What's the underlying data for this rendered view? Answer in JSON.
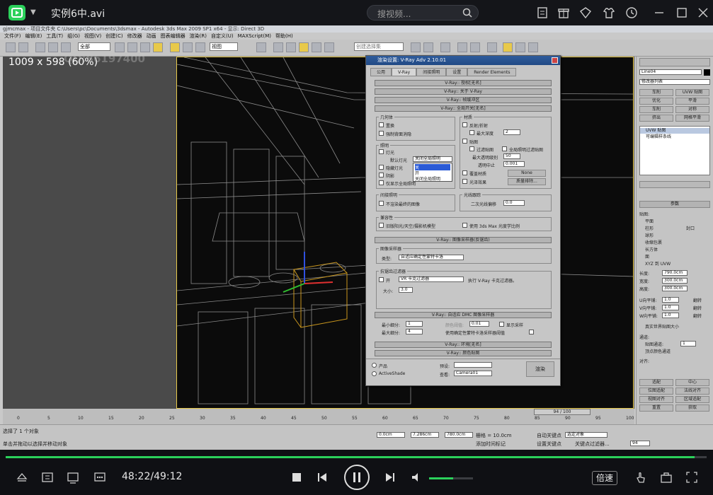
{
  "player": {
    "title": "实例6中.avi",
    "search_placeholder": "搜视频...",
    "time_text": "48:22/49:12",
    "progress": 0.983,
    "volume": 0.55,
    "speed_label": "倍速",
    "accent": "#2bd15b"
  },
  "app": {
    "title_bar": "gjmcmax - 项目文件夹 C:\\Users\\pc\\Documents\\3dsmax - Autodesk 3ds Max 2009 SP1 x64 - 显示: Direct 3D",
    "menus": [
      "文件(F)",
      "编辑(E)",
      "工具(T)",
      "组(G)",
      "视图(V)",
      "创建(C)",
      "修改器",
      "动画",
      "图表编辑器",
      "渲染(R)",
      "自定义(U)",
      "MAXScript(M)",
      "帮助(H)"
    ],
    "toolbar_dropdowns": {
      "selection": "全部",
      "view": "视图",
      "named_set": "创建选择集"
    },
    "viewport_label": "1009 x 598 (60%)",
    "watermark": "QQ:86197400"
  },
  "dialog": {
    "title": "渲染设置: V-Ray Adv 2.10.01",
    "tabs": [
      "公用",
      "V-Ray",
      "间接照明",
      "设置",
      "Render Elements"
    ],
    "rollouts_top": [
      "V-Ray:: 授权[无名]",
      "V-Ray:: 关于 V-Ray",
      "V-Ray:: 帧缓冲区",
      "V-Ray:: 全局开关[无名]"
    ],
    "geometry_label": "几何体",
    "geometry": [
      "置换",
      "强制背面消隐"
    ],
    "lighting_label": "照明",
    "lighting": [
      "灯光",
      "隐藏灯光",
      "阴影",
      "仅显示全局照明"
    ],
    "default_lights_label": "默认灯光",
    "default_lights_value": "关闭全局照明",
    "default_lights_options": [
      "关",
      "开",
      "关闭全局照明"
    ],
    "material_label": "材质",
    "material": [
      "反射/折射",
      "最大深度",
      "贴图",
      "过滤贴图",
      "全局照明过滤贴图",
      "最大透明级别",
      "透明中止",
      "覆盖材质",
      "光泽效果"
    ],
    "max_depth": "2",
    "max_transp": "50",
    "transp_cutoff": "0.001",
    "override_btn": "None",
    "gloss_btn": "质量排除...",
    "indirect_label": "间接照明",
    "indirect_opt": "不渲染最终的图像",
    "raytrace_label": "光线跟踪",
    "secondary_bias_label": "二次光线偏移",
    "secondary_bias": "0.0",
    "compat_label": "兼容性",
    "compat": [
      "旧版阳光/天空/摄影机模型",
      "使用 3ds Max 光度学比例"
    ],
    "rollout_sampler": "V-Ray:: 图像采样器(反锯齿)",
    "sampler_label": "图像采样器",
    "sampler_type_label": "类型:",
    "sampler_type": "自适应确定性蒙特卡洛",
    "aa_label": "抗锯齿过滤器",
    "aa_on": "开",
    "aa_filter": "VR 卡克过滤器",
    "aa_desc": "执行 V-Ray 卡克过滤器。",
    "aa_size_label": "大小:",
    "aa_size": "3.0",
    "rollout_dmc": "V-Ray:: 自适应 DMC 图像采样器",
    "min_subdiv_label": "最小细分:",
    "min_subdiv": "1",
    "max_subdiv_label": "最大细分:",
    "max_subdiv": "4",
    "color_thresh_label": "颜色阈值:",
    "color_thresh": "0.01",
    "show_samples": "显示采样",
    "use_dmc": "使用确定性蒙特卡洛采样器阈值",
    "rollout_env": "V-Ray:: 环境[无名]",
    "rollout_color": "V-Ray:: 颜色贴图",
    "mode_product": "产品",
    "mode_activeshade": "ActiveShade",
    "preset_label": "预设:",
    "view_label": "查看:",
    "view_value": "Camera01",
    "render_btn": "渲染"
  },
  "command_panel": {
    "object_name": "Line04",
    "modifier_list": "修改器列表",
    "buttons": [
      "车削",
      "UVW 贴图",
      "优化",
      "平滑",
      "车削",
      "对称",
      "挤出",
      "网格平滑"
    ],
    "stack": [
      "UVW 贴图",
      "可编辑样条线"
    ],
    "params_title": "参数",
    "mapping_label": "贴图:",
    "mapping_options": [
      "平面",
      "柱形",
      "封口",
      "球形",
      "收缩包裹",
      "长方体",
      "面",
      "XYZ 到 UVW"
    ],
    "length_label": "长度:",
    "length": "790.0cm",
    "width_label": "宽度:",
    "width": "300.0cm",
    "height_label": "高度:",
    "height": "300.0cm",
    "u_tile_label": "U向平铺:",
    "v_tile_label": "V向平铺:",
    "w_tile_label": "W向平铺:",
    "tile": "1.0",
    "flip": "翻转",
    "real_world": "真实世界贴图大小",
    "channel_label": "通道:",
    "map_channel_label": "贴图通道:",
    "map_channel": "1",
    "vertex_color": "顶点颜色通道",
    "align_label": "对齐:",
    "align_btns": [
      "适配",
      "中心",
      "位图适配",
      "法线对齐",
      "视图对齐",
      "区域适配",
      "重置",
      "获取"
    ]
  },
  "timeline": {
    "frame": "94 / 100",
    "ticks": [
      "0",
      "5",
      "10",
      "15",
      "20",
      "25",
      "30",
      "35",
      "40",
      "45",
      "50",
      "55",
      "60",
      "65",
      "70",
      "75",
      "80",
      "85",
      "90",
      "95",
      "100"
    ]
  },
  "status": {
    "selected": "选择了 1 个对象",
    "hint": "单击并拖动以选择并移动对象",
    "x": "0.0cm",
    "y": "7.286cm",
    "z": "780.0cm",
    "grid": "栅格 = 10.0cm",
    "autokey": "自动关键点",
    "selected_object": "选定对象",
    "setkey": "设置关键点",
    "key_filter": "关键点过滤器...",
    "add_time_tag": "添加时间标记",
    "frame_input": "94"
  }
}
